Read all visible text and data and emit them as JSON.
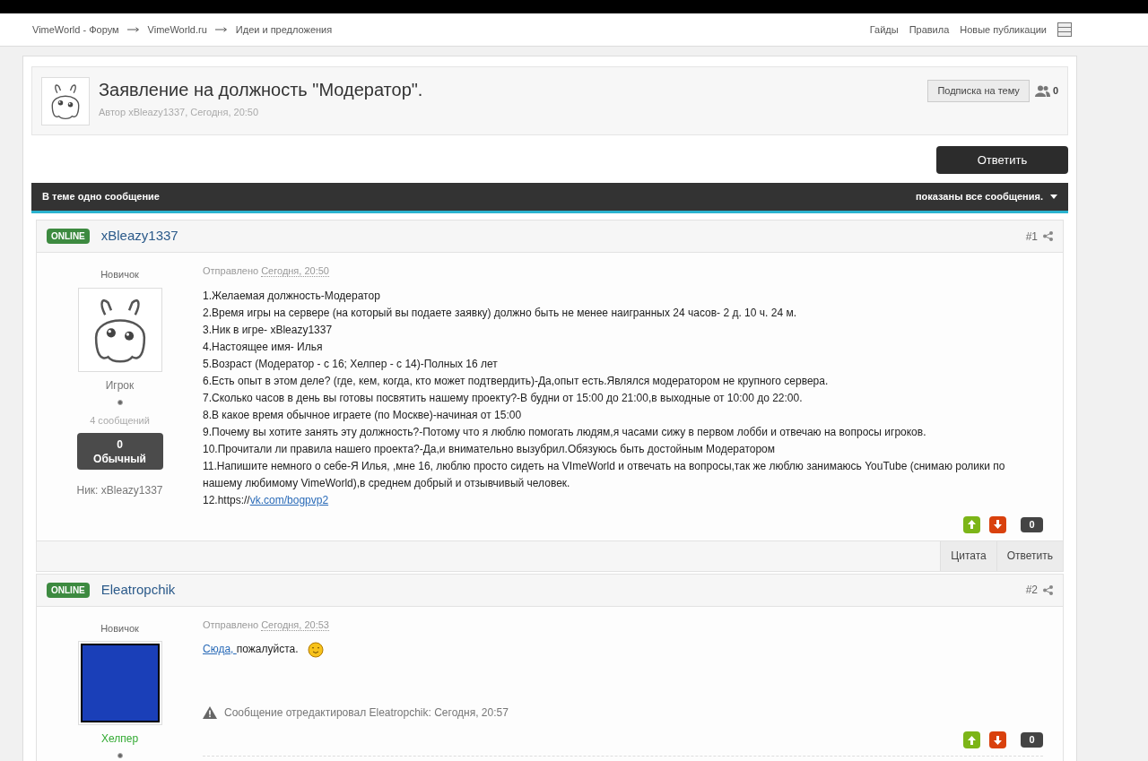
{
  "breadcrumbs": [
    "VimeWorld - Форум",
    "VimeWorld.ru",
    "Идеи и предложения"
  ],
  "top_links": [
    "Гайды",
    "Правила",
    "Новые публикации"
  ],
  "topic": {
    "title": "Заявление на должность \"Модератор\".",
    "meta": "Автор xBleazy1337, Сегодня, 20:50",
    "subscribe": "Подписка на тему",
    "followers": "0"
  },
  "reply_button": "Ответить",
  "bar": {
    "left": "В теме одно сообщение",
    "right": "показаны все сообщения."
  },
  "posts": [
    {
      "status": "ONLINE",
      "author": "xBleazy1337",
      "number": "#1",
      "rank": "Новичок",
      "avatar": {
        "kind": "mascot"
      },
      "group": {
        "text": "Игрок",
        "color": "#777777"
      },
      "post_count": "4 сообщений",
      "rep": "0",
      "rep_label": "Обычный",
      "nick": "Ник: xBleazy1337",
      "sent_label": "Отправлено",
      "sent_time": "Сегодня, 20:50",
      "paragraphs": [
        [
          {
            "kind": "text",
            "text": "1.Желаемая должность-Модератор"
          }
        ],
        [
          {
            "kind": "text",
            "text": "2.Время игры на сервере (на который вы подаете заявку) должно быть не менее наигранных 24 часов- 2 д. 10 ч. 24 м."
          }
        ],
        [
          {
            "kind": "text",
            "text": "3.Ник в игре- xBleazy1337"
          }
        ],
        [
          {
            "kind": "text",
            "text": "4.Настоящее имя- Илья"
          }
        ],
        [
          {
            "kind": "text",
            "text": "5.Возраст (Модератор - с 16; Хелпер - с 14)-Полных 16 лет"
          }
        ],
        [
          {
            "kind": "text",
            "text": "6.Есть опыт в этом деле? (где, кем, когда, кто может подтвердить)-Да,опыт есть.Являлся модератором не крупного сервера."
          }
        ],
        [
          {
            "kind": "text",
            "text": "7.Сколько часов в день вы готовы посвятить нашему проекту?-В будни от 15:00 до 21:00,в выходные от 10:00 до 22:00."
          }
        ],
        [
          {
            "kind": "text",
            "text": "8.В какое время обычное играете (по Москве)-начиная от 15:00"
          }
        ],
        [
          {
            "kind": "text",
            "text": "9.Почему вы хотите занять эту должность?-Потому что я люблю помогать людям,я часами сижу в первом лобби и отвечаю на вопросы игроков."
          }
        ],
        [
          {
            "kind": "text",
            "text": "10.Прочитали ли правила нашего проекта?-Да,и внимательно вызубрил.Обязуюсь быть достойным Модератором"
          }
        ],
        [
          {
            "kind": "text",
            "text": "11.Напишите немного о себе-Я Илья, ,мне 16, люблю просто сидеть на VImeWorld и отвечать на вопросы,так же люблю занимаюсь YouTube (снимаю ролики по нашему любимому VimeWorld),в среднем добрый и отзывчивый человек."
          }
        ],
        [
          {
            "kind": "text",
            "text": "12.https://"
          },
          {
            "kind": "link",
            "text": "vk.com/bogpvp2"
          }
        ]
      ],
      "votes": "0",
      "actions": [
        "Цитата",
        "Ответить"
      ]
    },
    {
      "status": "ONLINE",
      "author": "Eleatropchik",
      "number": "#2",
      "rank": "Новичок",
      "avatar": {
        "kind": "image"
      },
      "group": {
        "text": "Хелпер",
        "color": "#33aa33"
      },
      "sent_label": "Отправлено",
      "sent_time": "Сегодня, 20:53",
      "paragraphs": [
        [
          {
            "kind": "link",
            "text": "Сюда, "
          },
          {
            "kind": "text",
            "text": "пожалуйста."
          },
          {
            "kind": "emoji"
          }
        ]
      ],
      "edit_note": "Сообщение отредактировал Eleatropchik: Сегодня, 20:57",
      "votes": "0"
    }
  ]
}
